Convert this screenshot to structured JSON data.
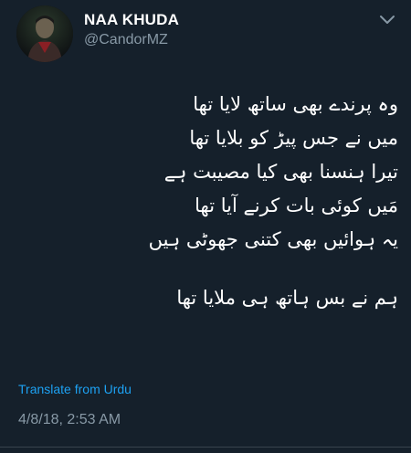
{
  "colors": {
    "background": "#15202b",
    "primary_text": "#ffffff",
    "secondary_text": "#8899a6",
    "link": "#1da1f2"
  },
  "author": {
    "display_name": "NAA KHUDA",
    "handle": "@CandorMZ"
  },
  "tweet": {
    "poem_lines": [
      "وہ پرندے بھی ساتھ لایا تھا",
      "میں نے جس پیڑ کو بلایا تھا",
      "تیرا ہنسنا بھی کیا مصیبت ہے",
      "مَیں کوئی بات کرنے آیا تھا",
      "یہ ہوائیں بھی کتنی جھوٹی ہیں"
    ],
    "final_line": "ہم نے بس ہاتھ ہی ملایا تھا",
    "translate_label": "Translate from Urdu",
    "timestamp": "4/8/18, 2:53 AM"
  },
  "icons": {
    "more_menu": "chevron-down-icon",
    "avatar": "profile-photo"
  }
}
